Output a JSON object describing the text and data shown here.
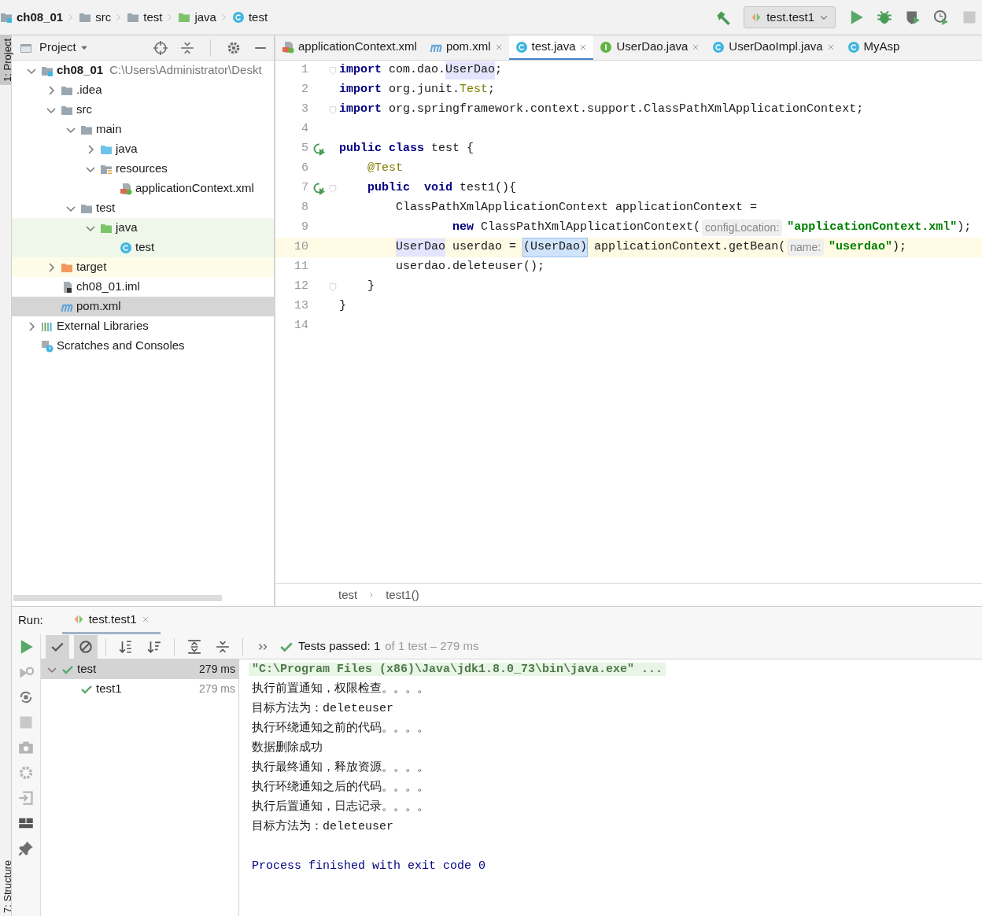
{
  "breadcrumbs": [
    {
      "label": "ch08_01",
      "kind": "module"
    },
    {
      "label": "src",
      "kind": "folder"
    },
    {
      "label": "test",
      "kind": "folder"
    },
    {
      "label": "java",
      "kind": "test_folder"
    },
    {
      "label": "test",
      "kind": "class"
    }
  ],
  "run_config": {
    "label": "test.test1"
  },
  "side_tabs": {
    "top": [
      {
        "label": "1: Project",
        "selected": true
      }
    ],
    "bottom": [
      {
        "label": "7: Structure",
        "selected": false
      }
    ]
  },
  "project_panel": {
    "title": "Project",
    "tree": [
      {
        "label": "ch08_01",
        "path": "C:\\Users\\Administrator\\Deskt",
        "kind": "module",
        "expanded": true,
        "selected": false,
        "children": [
          {
            "label": ".idea",
            "kind": "folder",
            "expanded": false,
            "selected": false
          },
          {
            "label": "src",
            "kind": "folder",
            "expanded": true,
            "selected": false,
            "children": [
              {
                "label": "main",
                "kind": "folder",
                "expanded": true,
                "selected": false,
                "children": [
                  {
                    "label": "java",
                    "kind": "source_folder",
                    "expanded": false,
                    "selected": false
                  },
                  {
                    "label": "resources",
                    "kind": "resources_folder",
                    "expanded": true,
                    "selected": false,
                    "children": [
                      {
                        "label": "applicationContext.xml",
                        "kind": "xml",
                        "selected": false
                      }
                    ]
                  }
                ]
              },
              {
                "label": "test",
                "kind": "folder",
                "expanded": true,
                "selected": false,
                "children": [
                  {
                    "label": "java",
                    "kind": "test_folder",
                    "expanded": true,
                    "selected": false,
                    "test_source": true,
                    "children": [
                      {
                        "label": "test",
                        "kind": "class",
                        "selected": false,
                        "test_source": true
                      }
                    ]
                  }
                ]
              }
            ]
          },
          {
            "label": "target",
            "kind": "excluded_folder",
            "expanded": false,
            "selected": false,
            "excluded": true
          },
          {
            "label": "ch08_01.iml",
            "kind": "iml",
            "selected": false
          },
          {
            "label": "pom.xml",
            "kind": "maven",
            "selected": true
          }
        ]
      },
      {
        "label": "External Libraries",
        "kind": "libraries",
        "expanded": false,
        "selected": false
      },
      {
        "label": "Scratches and Consoles",
        "kind": "scratches",
        "selected": false
      }
    ]
  },
  "editor_tabs": [
    {
      "label": "applicationContext.xml",
      "kind": "xml",
      "selected": false,
      "closable": false
    },
    {
      "label": "pom.xml",
      "kind": "maven",
      "selected": false,
      "closable": true
    },
    {
      "label": "test.java",
      "kind": "class",
      "selected": true,
      "closable": true
    },
    {
      "label": "UserDao.java",
      "kind": "interface",
      "selected": false,
      "closable": true
    },
    {
      "label": "UserDaoImpl.java",
      "kind": "class",
      "selected": false,
      "closable": true
    },
    {
      "label": "MyAsp",
      "kind": "class",
      "selected": false,
      "closable": false
    }
  ],
  "code_lines": [
    {
      "number": "1",
      "current": false,
      "fold": true,
      "tokens": [
        {
          "text": "import",
          "kind": "keyword"
        },
        {
          "text": " com.dao.",
          "kind": "plain"
        },
        {
          "text": "UserDao",
          "kind": "usage"
        },
        {
          "text": ";",
          "kind": "plain"
        }
      ]
    },
    {
      "number": "2",
      "current": false,
      "fold": false,
      "tokens": [
        {
          "text": "import",
          "kind": "keyword"
        },
        {
          "text": " org.junit.",
          "kind": "plain"
        },
        {
          "text": "Test",
          "kind": "annotation"
        },
        {
          "text": ";",
          "kind": "plain"
        }
      ]
    },
    {
      "number": "3",
      "current": false,
      "fold": true,
      "tokens": [
        {
          "text": "import",
          "kind": "keyword"
        },
        {
          "text": " org.springframework.context.support.ClassPathXmlApplicationContext;",
          "kind": "plain"
        }
      ]
    },
    {
      "number": "4",
      "current": false,
      "fold": false
    },
    {
      "number": "5",
      "current": false,
      "fold": false,
      "run": true,
      "tokens": [
        {
          "text": "public",
          "kind": "keyword"
        },
        {
          "text": " class",
          "kind": "keyword"
        },
        {
          "text": " test {",
          "kind": "plain"
        }
      ]
    },
    {
      "number": "6",
      "current": false,
      "fold": false,
      "tokens": [
        {
          "text": "    @Test",
          "kind": "annotation"
        }
      ]
    },
    {
      "number": "7",
      "current": false,
      "fold": true,
      "run": true,
      "tokens": [
        {
          "text": "    public",
          "kind": "keyword"
        },
        {
          "text": "  void",
          "kind": "keyword"
        },
        {
          "text": " test1(){",
          "kind": "plain"
        }
      ]
    },
    {
      "number": "8",
      "current": false,
      "fold": false,
      "tokens": [
        {
          "text": "        ClassPathXmlApplicationContext applicationContext =",
          "kind": "plain"
        }
      ]
    },
    {
      "number": "9",
      "current": false,
      "fold": false,
      "tokens": [
        {
          "text": "                new",
          "kind": "keyword"
        },
        {
          "text": " ClassPathXmlApplicationContext(",
          "kind": "plain"
        },
        {
          "text": "configLocation:",
          "kind": "hint"
        },
        {
          "text": "\"applicationContext.xml\"",
          "kind": "string"
        },
        {
          "text": ");",
          "kind": "plain"
        }
      ]
    },
    {
      "number": "10",
      "current": true,
      "fold": false,
      "tokens": [
        {
          "text": "        UserDao",
          "kind": "usage"
        },
        {
          "text": " userdao = ",
          "kind": "plain"
        },
        {
          "text": "(UserDao)",
          "kind": "selection"
        },
        {
          "text": " applicationContext.getBean(",
          "kind": "plain"
        },
        {
          "text": "name:",
          "kind": "hint"
        },
        {
          "text": "\"userdao\"",
          "kind": "string"
        },
        {
          "text": ");",
          "kind": "plain"
        }
      ]
    },
    {
      "number": "11",
      "current": false,
      "fold": false,
      "tokens": [
        {
          "text": "        userdao.deleteuser();",
          "kind": "plain"
        }
      ]
    },
    {
      "number": "12",
      "current": false,
      "fold": true,
      "tokens": [
        {
          "text": "    }",
          "kind": "plain"
        }
      ]
    },
    {
      "number": "13",
      "current": false,
      "fold": false,
      "tokens": [
        {
          "text": "}",
          "kind": "plain"
        }
      ]
    },
    {
      "number": "14",
      "current": false,
      "fold": false
    }
  ],
  "editor_breadcrumbs": [
    "test",
    "test1()"
  ],
  "run_panel": {
    "title": "Run:",
    "tab": "test.test1",
    "status": {
      "passed": "Tests passed: 1",
      "detail": "of 1 test – 279 ms"
    },
    "tests": [
      {
        "label": "test",
        "time": "279 ms",
        "expanded": true,
        "selected": true,
        "children": [
          {
            "label": "test1",
            "time": "279 ms",
            "selected": false
          }
        ]
      }
    ],
    "console": [
      {
        "text": "\"C:\\Program Files (x86)\\Java\\jdk1.8.0_73\\bin\\java.exe\" ...",
        "kind": "command"
      },
      {
        "text": "执行前置通知，权限检查。。。。",
        "kind": "output"
      },
      {
        "text": "目标方法为：deleteuser",
        "kind": "output"
      },
      {
        "text": "执行环绕通知之前的代码。。。。",
        "kind": "output"
      },
      {
        "text": "数据删除成功",
        "kind": "output"
      },
      {
        "text": "执行最终通知，释放资源。。。。",
        "kind": "output"
      },
      {
        "text": "执行环绕通知之后的代码。。。。",
        "kind": "output"
      },
      {
        "text": "执行后置通知，日志记录。。。。",
        "kind": "output"
      },
      {
        "text": "目标方法为：deleteuser",
        "kind": "output"
      },
      {
        "text": "Process finished with exit code 0",
        "kind": "exit"
      }
    ]
  }
}
